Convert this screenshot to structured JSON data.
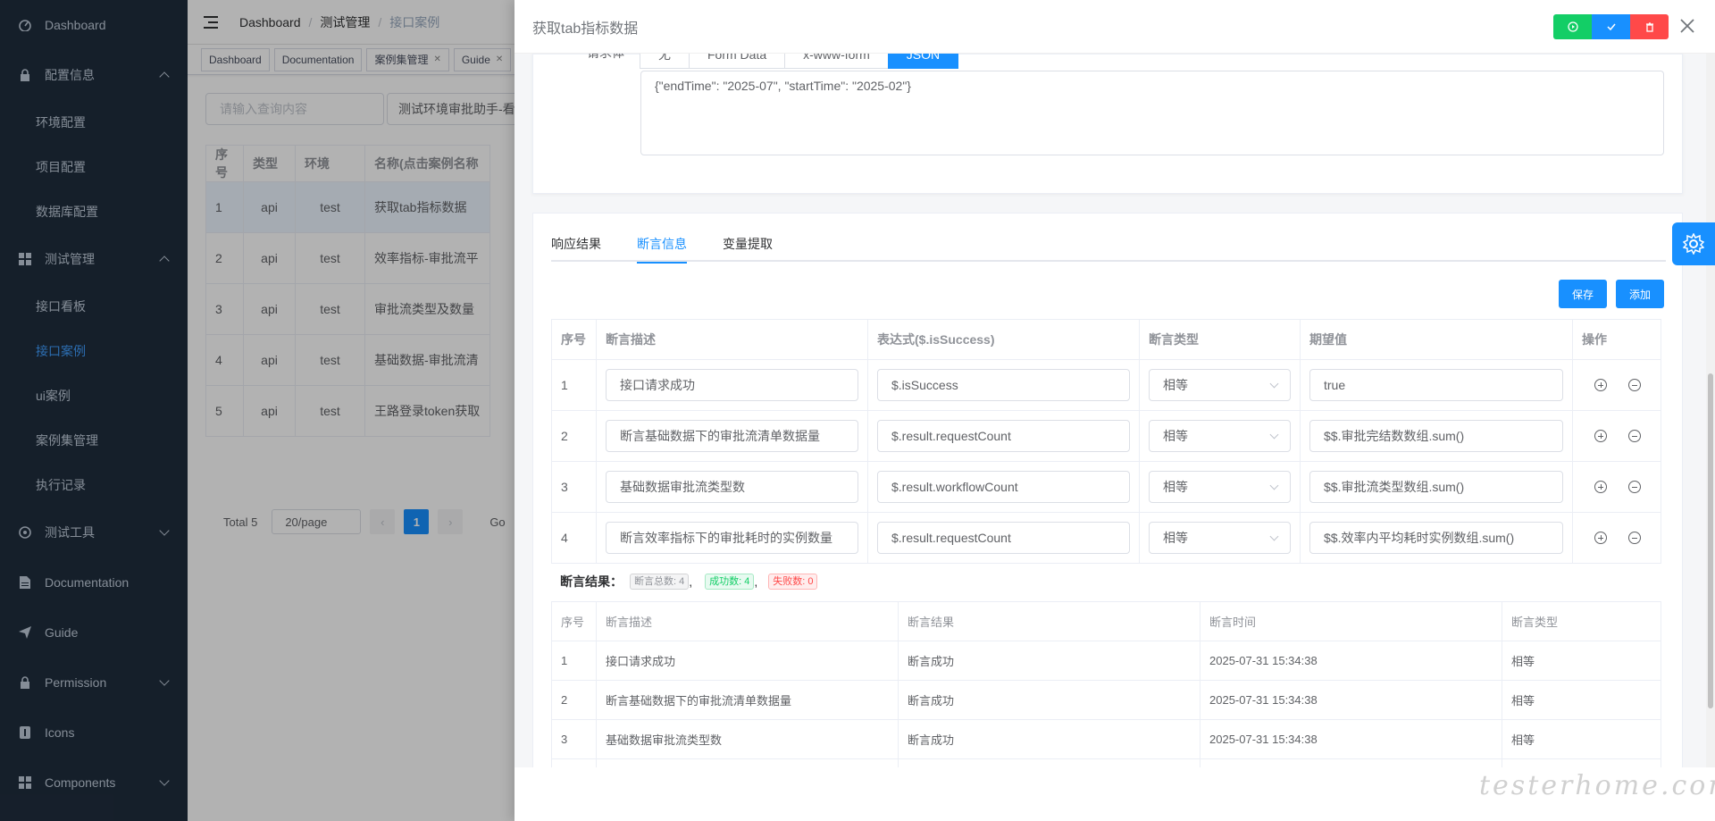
{
  "sidebar": {
    "items": [
      {
        "label": "Dashboard",
        "icon": "dashboard-icon"
      },
      {
        "label": "配置信息",
        "icon": "lock-icon",
        "expanded": true
      },
      {
        "label": "环境配置"
      },
      {
        "label": "项目配置"
      },
      {
        "label": "数据库配置"
      },
      {
        "label": "测试管理",
        "icon": "grid-icon",
        "expanded": true
      },
      {
        "label": "接口看板"
      },
      {
        "label": "接口案例",
        "active": true
      },
      {
        "label": "ui案例"
      },
      {
        "label": "案例集管理"
      },
      {
        "label": "执行记录"
      },
      {
        "label": "测试工具",
        "icon": "tool-icon"
      },
      {
        "label": "Documentation",
        "icon": "document-icon"
      },
      {
        "label": "Guide",
        "icon": "send-icon"
      },
      {
        "label": "Permission",
        "icon": "lock-icon"
      },
      {
        "label": "Icons",
        "icon": "icons-icon"
      },
      {
        "label": "Components",
        "icon": "grid-icon"
      }
    ]
  },
  "breadcrumb": [
    "Dashboard",
    "测试管理",
    "接口案例"
  ],
  "tags": [
    "Dashboard",
    "Documentation",
    "案例集管理",
    "Guide"
  ],
  "search": {
    "placeholder": "请输入查询内容",
    "select_value": "测试环境审批助手-看"
  },
  "case_table": {
    "headers": [
      "序号",
      "类型",
      "环境",
      "名称(点击案例名称"
    ],
    "rows": [
      [
        "1",
        "api",
        "test",
        "获取tab指标数据"
      ],
      [
        "2",
        "api",
        "test",
        "效率指标-审批流平"
      ],
      [
        "3",
        "api",
        "test",
        "审批流类型及数量"
      ],
      [
        "4",
        "api",
        "test",
        "基础数据-审批流清"
      ],
      [
        "5",
        "api",
        "test",
        "王路登录token获取"
      ]
    ]
  },
  "pager": {
    "total": "Total 5",
    "size": "20/page",
    "current": "1",
    "goto": "Go"
  },
  "drawer": {
    "title": "获取tab指标数据",
    "body_label": "请求体",
    "body_tabs": [
      "无",
      "Form Data",
      "x-www-form",
      "JSON"
    ],
    "json_body": "{\"endTime\": \"2025-07\", \"startTime\": \"2025-02\"}",
    "tabs": [
      "响应结果",
      "断言信息",
      "变量提取"
    ],
    "save_label": "保存",
    "add_label": "添加",
    "assert_headers": [
      "序号",
      "断言描述",
      "表达式($.isSuccess)",
      "断言类型",
      "期望值",
      "操作"
    ],
    "asserts": [
      {
        "no": "1",
        "desc": "接口请求成功",
        "expr": "$.isSuccess",
        "type": "相等",
        "expect": "true"
      },
      {
        "no": "2",
        "desc": "断言基础数据下的审批流清单数据量",
        "expr": "$.result.requestCount",
        "type": "相等",
        "expect": "$$.审批完结数数组.sum()"
      },
      {
        "no": "3",
        "desc": "基础数据审批流类型数",
        "expr": "$.result.workflowCount",
        "type": "相等",
        "expect": "$$.审批流类型数组.sum()"
      },
      {
        "no": "4",
        "desc": "断言效率指标下的审批耗时的实例数量",
        "expr": "$.result.requestCount",
        "type": "相等",
        "expect": "$$.效率内平均耗时实例数组.sum()"
      }
    ],
    "result_label": "断言结果：",
    "result_total": "断言总数: 4",
    "result_ok": "成功数: 4",
    "result_fail": "失败数: 0",
    "result_headers": [
      "序号",
      "断言描述",
      "断言结果",
      "断言时间",
      "断言类型"
    ],
    "results": [
      [
        "1",
        "接口请求成功",
        "断言成功",
        "2025-07-31 15:34:38",
        "相等"
      ],
      [
        "2",
        "断言基础数据下的审批流清单数据量",
        "断言成功",
        "2025-07-31 15:34:38",
        "相等"
      ],
      [
        "3",
        "基础数据审批流类型数",
        "断言成功",
        "2025-07-31 15:34:38",
        "相等"
      ]
    ]
  },
  "watermark": "testerhome.com",
  "colors": {
    "primary": "#1890ff",
    "success": "#13ce66",
    "danger": "#ff4949",
    "sidebar": "#1f2d3d"
  }
}
